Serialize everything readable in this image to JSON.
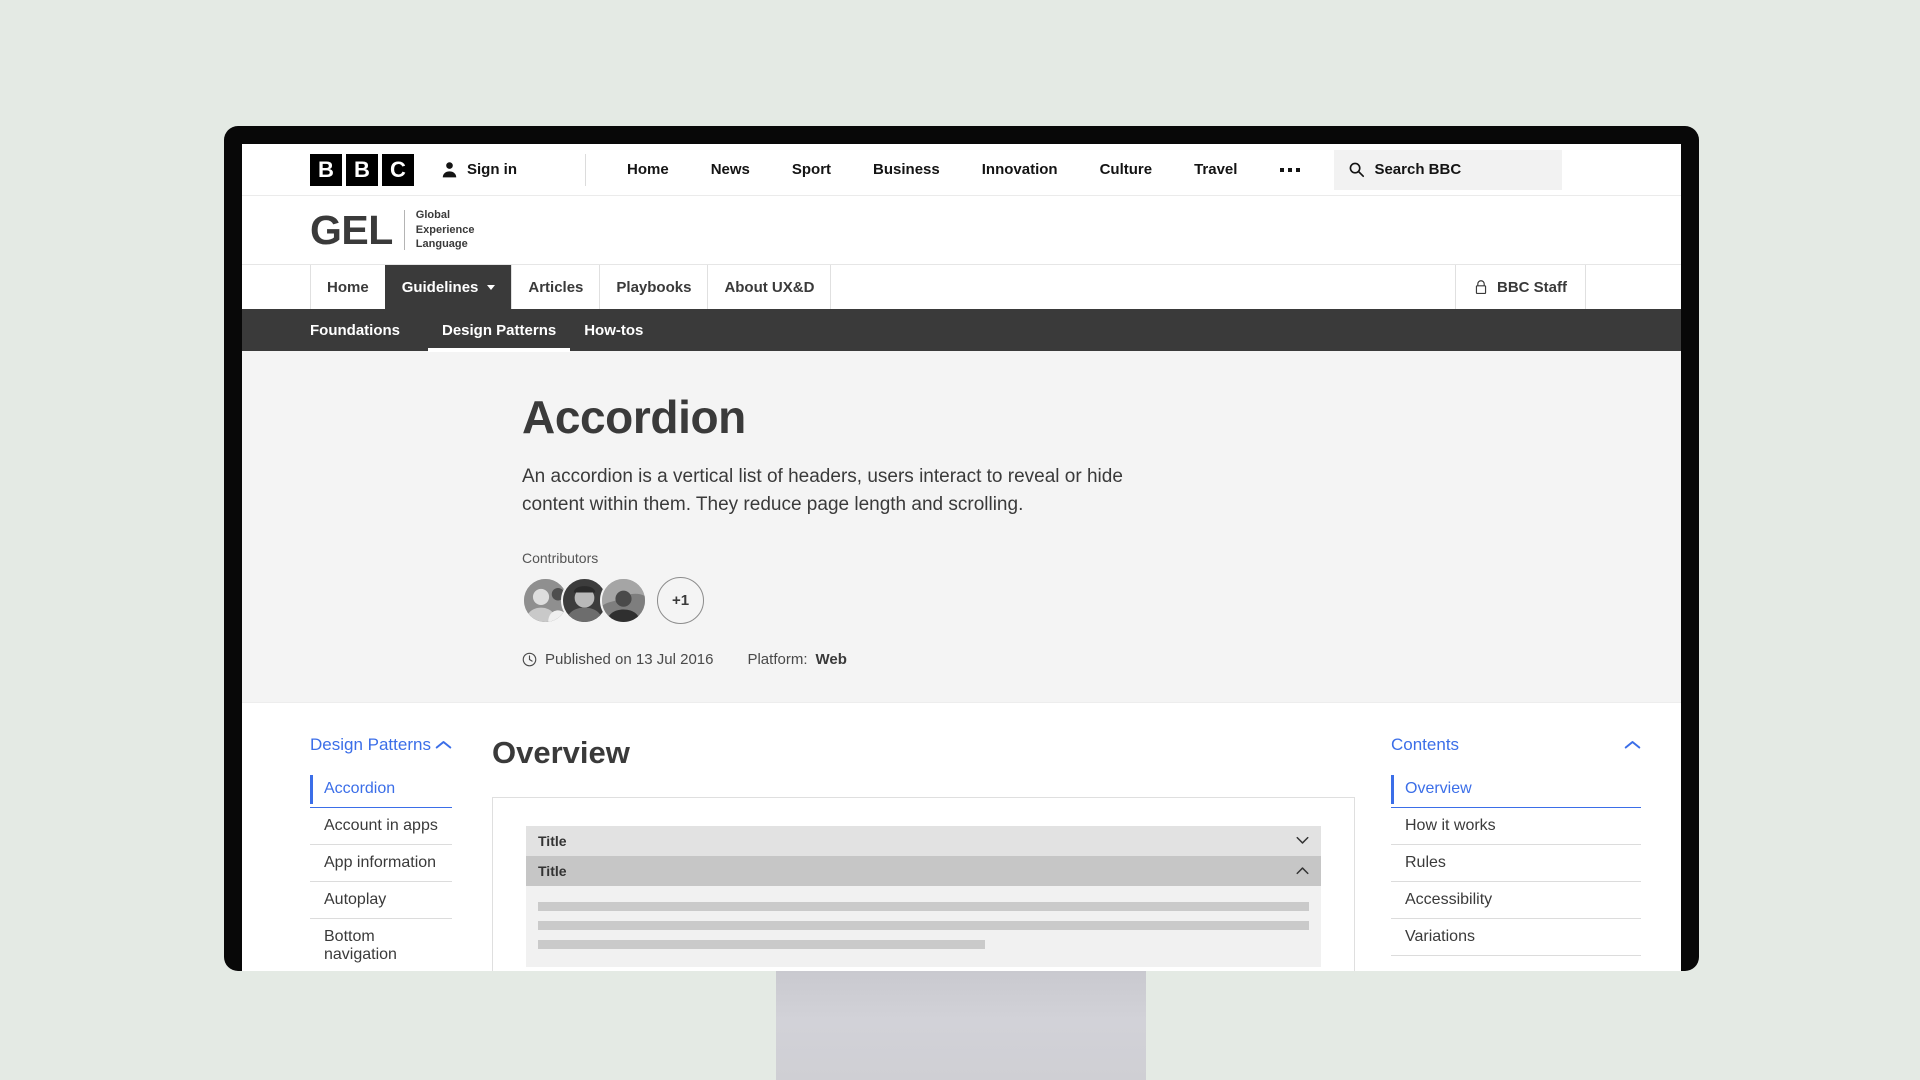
{
  "bbc_bar": {
    "logo_letters": [
      "B",
      "B",
      "C"
    ],
    "signin_label": "Sign in",
    "nav": [
      "Home",
      "News",
      "Sport",
      "Business",
      "Innovation",
      "Culture",
      "Travel"
    ],
    "more_label": "More",
    "search_label": "Search BBC"
  },
  "masthead": {
    "logo_word": "GEL",
    "logo_sub_line1": "Global",
    "logo_sub_line2": "Experience",
    "logo_sub_line3": "Language"
  },
  "tabs": {
    "items": [
      {
        "label": "Home",
        "active": false,
        "has_caret": false
      },
      {
        "label": "Guidelines",
        "active": true,
        "has_caret": true
      },
      {
        "label": "Articles",
        "active": false,
        "has_caret": false
      },
      {
        "label": "Playbooks",
        "active": false,
        "has_caret": false
      },
      {
        "label": "About UX&D",
        "active": false,
        "has_caret": false
      }
    ],
    "staff_label": "BBC Staff"
  },
  "subnav": {
    "items": [
      {
        "label": "Foundations",
        "active": false
      },
      {
        "label": "Design Patterns",
        "active": true
      },
      {
        "label": "How-tos",
        "active": false
      }
    ]
  },
  "hero": {
    "title": "Accordion",
    "description": "An accordion is a vertical list of headers, users interact to reveal or hide content within them. They reduce page length and scrolling.",
    "contributors_label": "Contributors",
    "contributors_extra": "+1",
    "published_text": "Published on 13 Jul 2016",
    "platform_label": "Platform:",
    "platform_value": "Web"
  },
  "left_sidebar": {
    "heading": "Design Patterns",
    "items": [
      {
        "label": "Accordion",
        "active": true
      },
      {
        "label": "Account in apps",
        "active": false
      },
      {
        "label": "App information",
        "active": false
      },
      {
        "label": "Autoplay",
        "active": false
      },
      {
        "label": "Bottom navigation",
        "active": false
      }
    ]
  },
  "right_sidebar": {
    "heading": "Contents",
    "items": [
      {
        "label": "Overview",
        "active": true
      },
      {
        "label": "How it works",
        "active": false
      },
      {
        "label": "Rules",
        "active": false
      },
      {
        "label": "Accessibility",
        "active": false
      },
      {
        "label": "Variations",
        "active": false
      }
    ]
  },
  "main": {
    "section_title": "Overview",
    "demo": {
      "rows": [
        {
          "title": "Title",
          "state": "collapsed"
        },
        {
          "title": "Title",
          "state": "expanded"
        }
      ]
    }
  },
  "colors": {
    "accent_blue": "#3b6ee8",
    "dark_nav": "#3a3a3a",
    "hero_bg": "#f4f4f4",
    "page_bg": "#e4eae4"
  }
}
